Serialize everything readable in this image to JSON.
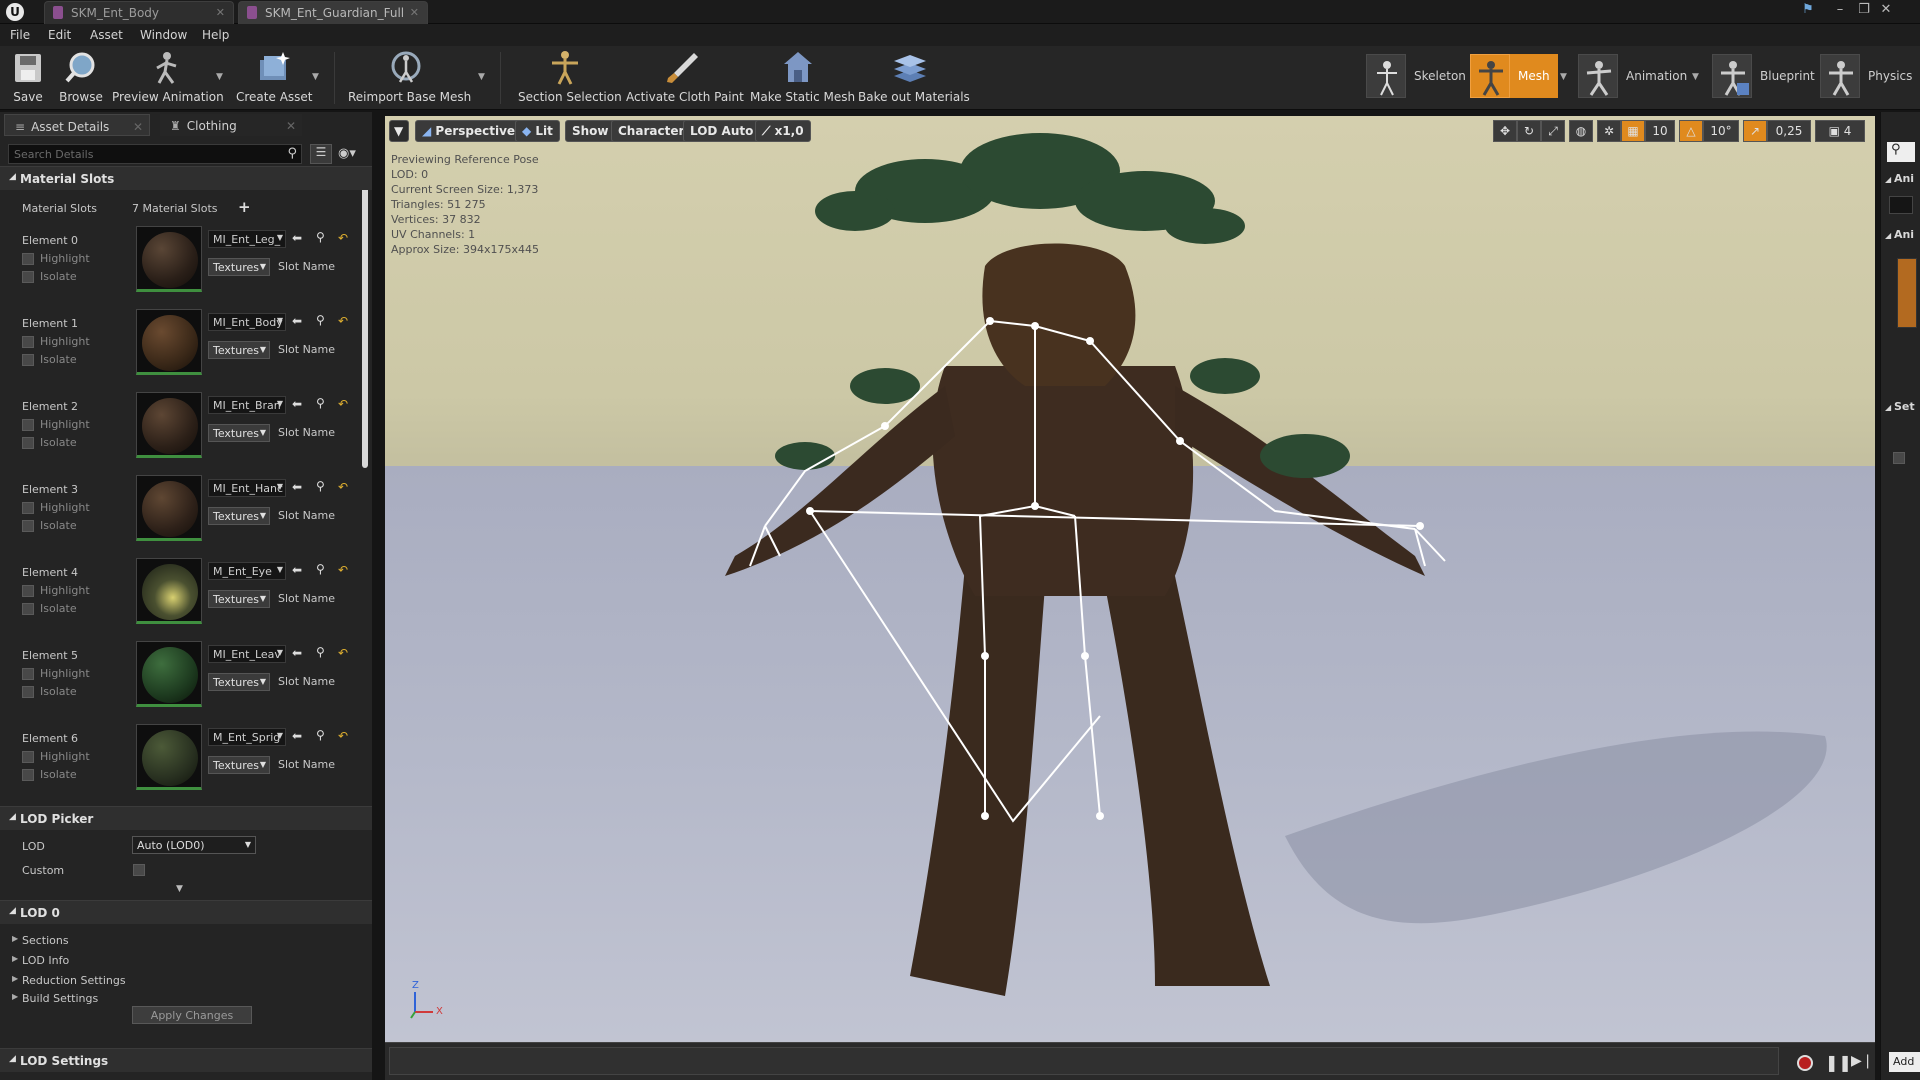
{
  "document_tabs": [
    {
      "label": "SKM_Ent_Body",
      "active": false
    },
    {
      "label": "SKM_Ent_Guardian_Full",
      "active": true
    }
  ],
  "menu": [
    "File",
    "Edit",
    "Asset",
    "Window",
    "Help"
  ],
  "toolbar": {
    "buttons": {
      "save": "Save",
      "browse": "Browse",
      "preview_animation": "Preview Animation",
      "create_asset": "Create Asset",
      "reimport_base_mesh": "Reimport Base Mesh",
      "section_selection": "Section Selection",
      "activate_cloth_paint": "Activate Cloth Paint",
      "make_static_mesh": "Make Static Mesh",
      "bake_out_materials": "Bake out Materials"
    },
    "modes": {
      "skeleton": "Skeleton",
      "mesh": "Mesh",
      "animation": "Animation",
      "blueprint": "Blueprint",
      "physics": "Physics"
    },
    "active_mode": "Mesh",
    "accent_color": "#e08a1e"
  },
  "details_panel": {
    "tabs": [
      "Asset Details",
      "Clothing"
    ],
    "search_placeholder": "Search Details",
    "material_slots": {
      "header": "Material Slots",
      "label": "Material Slots",
      "count_label": "7 Material Slots",
      "highlight_label": "Highlight",
      "isolate_label": "Isolate",
      "textures_label": "Textures",
      "slot_name_label": "Slot Name",
      "elements": [
        {
          "label": "Element 0",
          "material": "MI_Ent_Leg_"
        },
        {
          "label": "Element 1",
          "material": "MI_Ent_Body"
        },
        {
          "label": "Element 2",
          "material": "MI_Ent_Bran"
        },
        {
          "label": "Element 3",
          "material": "MI_Ent_Hanc"
        },
        {
          "label": "Element 4",
          "material": "M_Ent_Eye"
        },
        {
          "label": "Element 5",
          "material": "MI_Ent_Leav"
        },
        {
          "label": "Element 6",
          "material": "M_Ent_Sprig"
        }
      ]
    },
    "lod_picker": {
      "header": "LOD Picker",
      "lod_label": "LOD",
      "lod_value": "Auto (LOD0)",
      "custom_label": "Custom"
    },
    "lod0": {
      "header": "LOD 0",
      "items": [
        "Sections",
        "LOD Info",
        "Reduction Settings",
        "Build Settings"
      ],
      "apply_button": "Apply Changes"
    },
    "lod_settings_header": "LOD Settings"
  },
  "viewport": {
    "buttons": {
      "perspective": "Perspective",
      "lit": "Lit",
      "show": "Show",
      "character": "Character",
      "lod_auto": "LOD Auto",
      "speed": "x1,0"
    },
    "right_tools": {
      "grid_snap": "10",
      "rot_snap": "10°",
      "scale_snap": "0,25",
      "camera_speed": "4"
    },
    "info": [
      "Previewing Reference Pose",
      "LOD: 0",
      "Current Screen Size: 1,373",
      "Triangles: 51 275",
      "Vertices: 37 832",
      "UV Channels: 1",
      "Approx Size: 394x175x445"
    ],
    "axis": {
      "z": "Z",
      "x": "X"
    }
  },
  "right_panel": {
    "section1": "Ani",
    "section2": "Ani",
    "section3": "Set",
    "add_button": "Add"
  }
}
